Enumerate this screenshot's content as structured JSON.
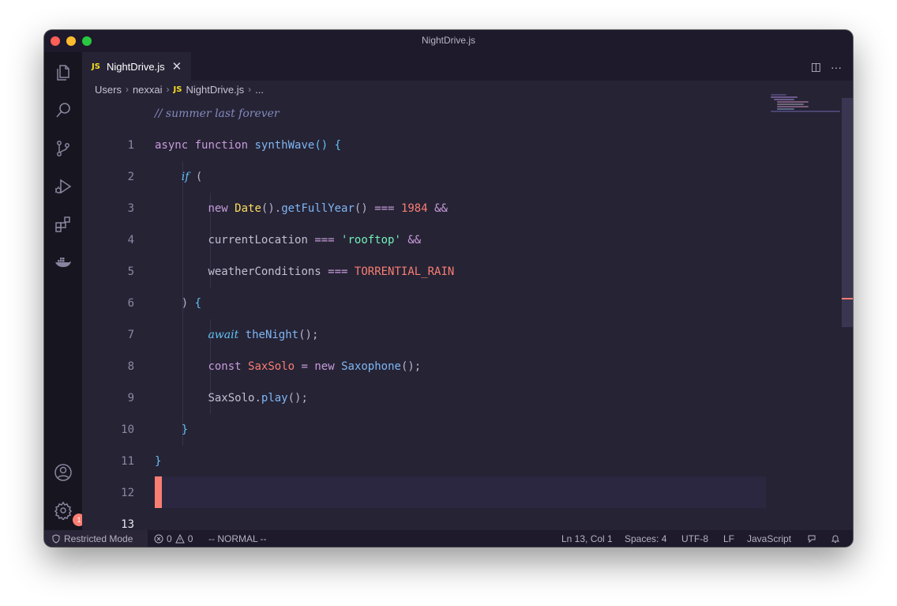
{
  "window": {
    "title": "NightDrive.js"
  },
  "tab": {
    "badge": "JS",
    "label": "NightDrive.js",
    "close": "✕"
  },
  "tab_actions": {
    "split": "◫",
    "more": "···"
  },
  "breadcrumb": {
    "items": [
      "Users",
      "nexxai",
      "NightDrive.js",
      "..."
    ],
    "separator": "›",
    "file_badge": "JS"
  },
  "activity_badge": "1",
  "editor": {
    "current_line": 13,
    "line_numbers": [
      "1",
      "2",
      "3",
      "4",
      "5",
      "6",
      "7",
      "8",
      "9",
      "10",
      "11",
      "12",
      "13"
    ],
    "code": {
      "l1": {
        "comment": "// summer last forever"
      },
      "l2": {
        "kw1": "async",
        "kw2": "function",
        "name": "synthWave",
        "rest": "() {"
      },
      "l3": {
        "kw": "if",
        "rest": " ("
      },
      "l4": {
        "kw": "new",
        "cls": "Date",
        "p1": "().",
        "method": "getFullYear",
        "p2": "()",
        "op": "===",
        "num": "1984",
        "and": "&&"
      },
      "l5": {
        "var": "currentLocation",
        "op": "===",
        "str": "'rooftop'",
        "and": "&&"
      },
      "l6": {
        "var": "weatherConditions",
        "op": "===",
        "const": "TORRENTIAL_RAIN"
      },
      "l7": {
        "paren": ")",
        "brace": "{"
      },
      "l8": {
        "kw": "await",
        "fn": "theNight",
        "rest": "();"
      },
      "l9": {
        "kw": "const",
        "var": "SaxSolo",
        "eq": "=",
        "kw2": "new",
        "cls": "Saxophone",
        "rest": "();"
      },
      "l10": {
        "obj": "SaxSolo",
        "dot": ".",
        "method": "play",
        "rest": "();"
      },
      "l11": {
        "brace": "}"
      },
      "l12": {
        "brace": "}"
      }
    }
  },
  "status": {
    "restricted": "Restricted Mode",
    "errors": "0",
    "warnings": "0",
    "mode": "-- NORMAL --",
    "position": "Ln 13, Col 1",
    "spaces": "Spaces: 4",
    "encoding": "UTF-8",
    "eol": "LF",
    "language": "JavaScript"
  },
  "colors": {
    "background": "#262335",
    "sidebar": "#171520",
    "cursor": "#f97e72",
    "keyword": "#fede5d",
    "string": "#ff8b39"
  }
}
